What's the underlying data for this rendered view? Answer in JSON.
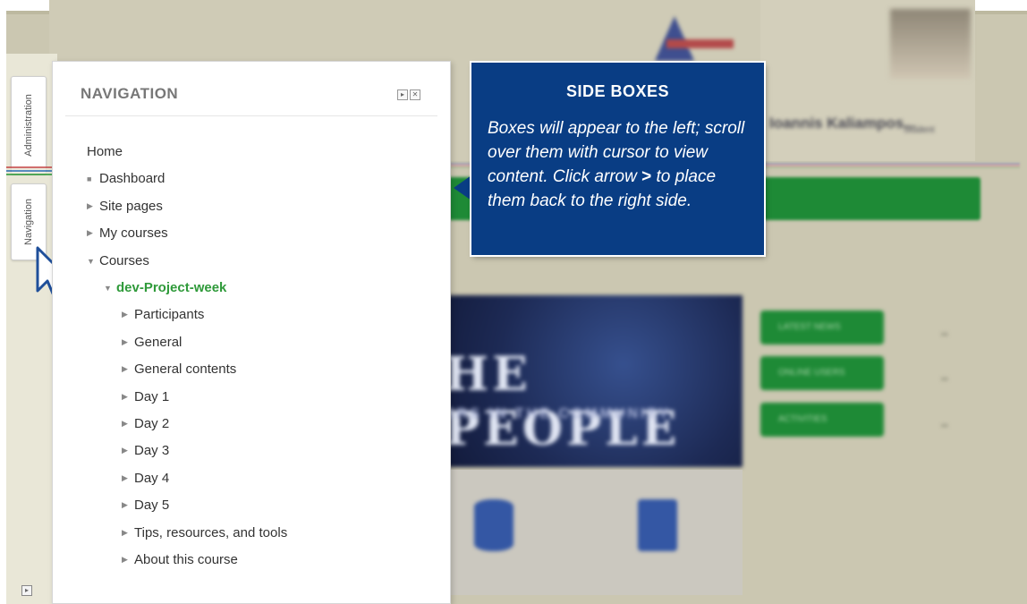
{
  "dock": {
    "tabs": [
      "Administration",
      "Navigation"
    ]
  },
  "navigation": {
    "title": "NAVIGATION",
    "controls": [
      "▸",
      "✕"
    ],
    "items": [
      {
        "label": "Home",
        "level": 0,
        "marker": ""
      },
      {
        "label": "Dashboard",
        "level": 1,
        "marker": "■"
      },
      {
        "label": "Site pages",
        "level": 1,
        "marker": "▶"
      },
      {
        "label": "My courses",
        "level": 1,
        "marker": "▶"
      },
      {
        "label": "Courses",
        "level": 1,
        "marker": "▼"
      },
      {
        "label": "dev-Project-week",
        "level": 2,
        "marker": "▼",
        "active": true
      },
      {
        "label": "Participants",
        "level": 3,
        "marker": "▶"
      },
      {
        "label": "General",
        "level": 3,
        "marker": "▶"
      },
      {
        "label": "General contents",
        "level": 3,
        "marker": "▶"
      },
      {
        "label": "Day 1",
        "level": 3,
        "marker": "▶"
      },
      {
        "label": "Day 2",
        "level": 3,
        "marker": "▶"
      },
      {
        "label": "Day 3",
        "level": 3,
        "marker": "▶"
      },
      {
        "label": "Day 4",
        "level": 3,
        "marker": "▶"
      },
      {
        "label": "Day 5",
        "level": 3,
        "marker": "▶"
      },
      {
        "label": "Tips, resources, and tools",
        "level": 3,
        "marker": "▶"
      },
      {
        "label": "About this course",
        "level": 3,
        "marker": "▶"
      }
    ]
  },
  "callout": {
    "title": "SIDE BOXES",
    "body_pre": "Boxes will appear to the left; scroll over them with cursor to view content. Click arrow ",
    "body_symbol": ">",
    "body_post": " to place them back to the right side."
  },
  "background": {
    "user_name": "Ioannis Kaliampos...",
    "user_role": "Student",
    "banner_text": "HE PEOPLE",
    "banner_sub": "ERS IN THE COMMUNITY",
    "side_tabs": [
      "LATEST NEWS",
      "ONLINE USERS",
      "ACTIVITIES"
    ]
  },
  "colors": {
    "callout_bg": "#093d84",
    "active_course": "#2f9a3a"
  }
}
